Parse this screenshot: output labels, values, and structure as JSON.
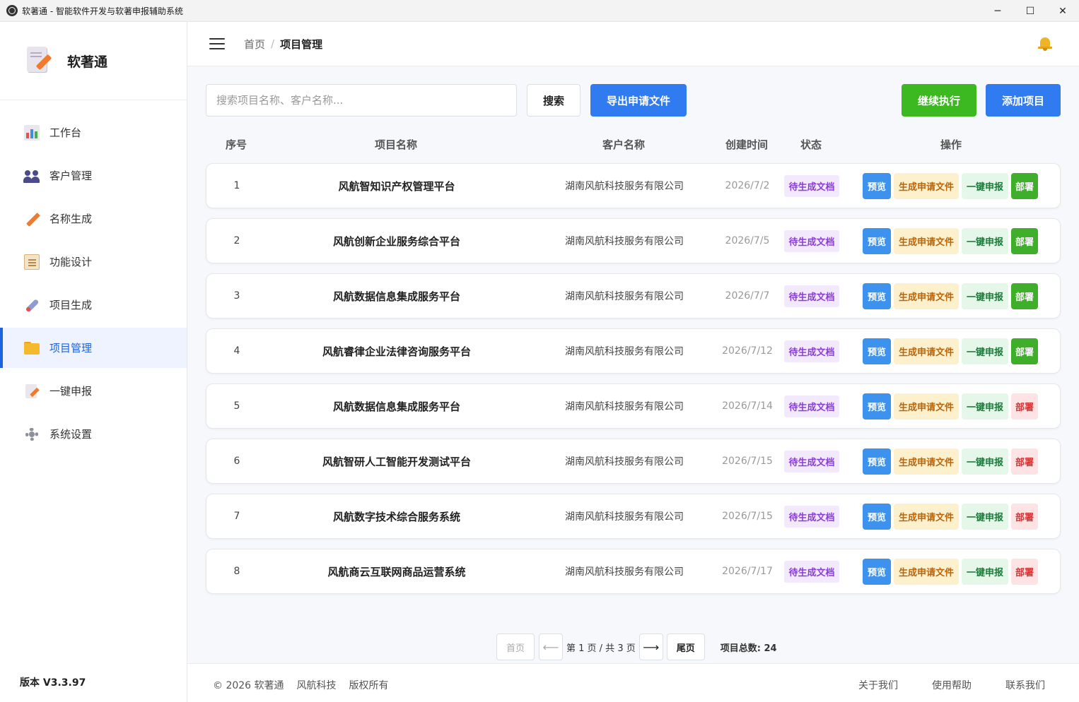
{
  "window": {
    "title": "软著通 - 智能软件开发与软著申报辅助系统",
    "controls": {
      "minimize": "─",
      "maximize": "☐",
      "close": "✕"
    }
  },
  "sidebar": {
    "brand": "软著通",
    "items": [
      {
        "label": "工作台",
        "icon": "chart-icon",
        "active": false
      },
      {
        "label": "客户管理",
        "icon": "users-icon",
        "active": false
      },
      {
        "label": "名称生成",
        "icon": "pencil-icon",
        "active": false
      },
      {
        "label": "功能设计",
        "icon": "clipboard-icon",
        "active": false
      },
      {
        "label": "项目生成",
        "icon": "rocket-icon",
        "active": false
      },
      {
        "label": "项目管理",
        "icon": "folder-icon",
        "active": true
      },
      {
        "label": "一键申报",
        "icon": "document-pencil-icon",
        "active": false
      },
      {
        "label": "系统设置",
        "icon": "gear-icon",
        "active": false
      }
    ],
    "version": "版本 V3.3.97"
  },
  "header": {
    "breadcrumb": {
      "home": "首页",
      "separator": "/",
      "current": "项目管理"
    }
  },
  "toolbar": {
    "search_placeholder": "搜索项目名称、客户名称...",
    "search_value": "",
    "search_button": "搜索",
    "export_button": "导出申请文件",
    "continue_button": "继续执行",
    "add_button": "添加项目"
  },
  "table": {
    "headers": {
      "no": "序号",
      "name": "项目名称",
      "client": "客户名称",
      "date": "创建时间",
      "status": "状态",
      "ops": "操作"
    },
    "action_labels": {
      "preview": "预览",
      "generate": "生成申请文件",
      "submit": "一键申报",
      "deploy": "部署"
    },
    "rows": [
      {
        "no": "1",
        "name": "风航智知识产权管理平台",
        "client": "湖南风航科技服务有限公司",
        "date": "2026/7/2",
        "status": "待生成文档",
        "deploy_state": "ok"
      },
      {
        "no": "2",
        "name": "风航创新企业服务综合平台",
        "client": "湖南风航科技服务有限公司",
        "date": "2026/7/5",
        "status": "待生成文档",
        "deploy_state": "ok"
      },
      {
        "no": "3",
        "name": "风航数据信息集成服务平台",
        "client": "湖南风航科技服务有限公司",
        "date": "2026/7/7",
        "status": "待生成文档",
        "deploy_state": "ok"
      },
      {
        "no": "4",
        "name": "风航睿律企业法律咨询服务平台",
        "client": "湖南风航科技服务有限公司",
        "date": "2026/7/12",
        "status": "待生成文档",
        "deploy_state": "ok"
      },
      {
        "no": "5",
        "name": "风航数据信息集成服务平台",
        "client": "湖南风航科技服务有限公司",
        "date": "2026/7/14",
        "status": "待生成文档",
        "deploy_state": "pending"
      },
      {
        "no": "6",
        "name": "风航智研人工智能开发测试平台",
        "client": "湖南风航科技服务有限公司",
        "date": "2026/7/15",
        "status": "待生成文档",
        "deploy_state": "pending"
      },
      {
        "no": "7",
        "name": "风航数字技术综合服务系统",
        "client": "湖南风航科技服务有限公司",
        "date": "2026/7/15",
        "status": "待生成文档",
        "deploy_state": "pending"
      },
      {
        "no": "8",
        "name": "风航商云互联网商品运营系统",
        "client": "湖南风航科技服务有限公司",
        "date": "2026/7/17",
        "status": "待生成文档",
        "deploy_state": "pending"
      }
    ]
  },
  "pagination": {
    "first": "首页",
    "prev": "⟵",
    "info": "第 1 页 / 共 3 页",
    "next": "⟶",
    "last": "尾页",
    "total": "项目总数: 24"
  },
  "footer": {
    "copyright": "© 2026 软著通",
    "company": "风航科技",
    "rights": "版权所有",
    "links": [
      "关于我们",
      "使用帮助",
      "联系我们"
    ]
  },
  "colors": {
    "primary": "#2f7bef",
    "success": "#3cb820",
    "status_purple": "#8a3ed8",
    "deploy_pending": "#cf3434"
  }
}
